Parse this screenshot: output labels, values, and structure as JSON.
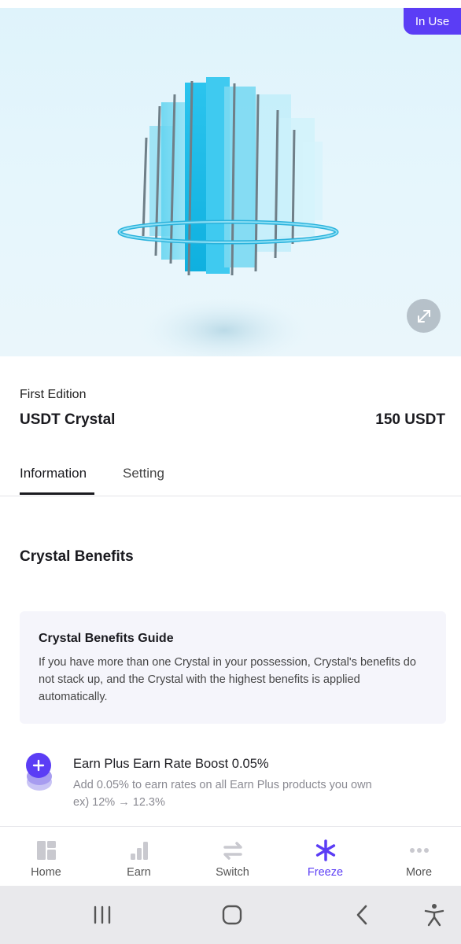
{
  "hero": {
    "badge": "In Use",
    "expand_icon": "expand-arrows-icon",
    "accent_color": "#5b3df5"
  },
  "item": {
    "edition": "First Edition",
    "name": "USDT Crystal",
    "price": "150 USDT"
  },
  "tabs": [
    {
      "label": "Information",
      "active": true
    },
    {
      "label": "Setting",
      "active": false
    }
  ],
  "section": {
    "title": "Crystal Benefits"
  },
  "guide": {
    "title": "Crystal Benefits Guide",
    "text": "If you have more than one Crystal in your possession, Crystal's benefits do not stack up, and the Crystal with the highest benefits is applied automatically."
  },
  "benefit": {
    "icon": "plus-coin-icon",
    "title": "Earn Plus Earn Rate Boost 0.05%",
    "desc_line1": "Add 0.05% to earn rates on all Earn Plus products you own",
    "desc_line2": "ex) 12% → 12.3%"
  },
  "nav": [
    {
      "label": "Home",
      "icon": "home-grid-icon"
    },
    {
      "label": "Earn",
      "icon": "bar-chart-icon"
    },
    {
      "label": "Switch",
      "icon": "switch-arrows-icon"
    },
    {
      "label": "Freeze",
      "icon": "asterisk-icon",
      "active": true
    },
    {
      "label": "More",
      "icon": "more-dots-icon"
    }
  ],
  "system": {
    "recents_icon": "recents-icon",
    "home_icon": "home-button-icon",
    "back_icon": "back-icon",
    "accessibility_icon": "accessibility-icon"
  }
}
